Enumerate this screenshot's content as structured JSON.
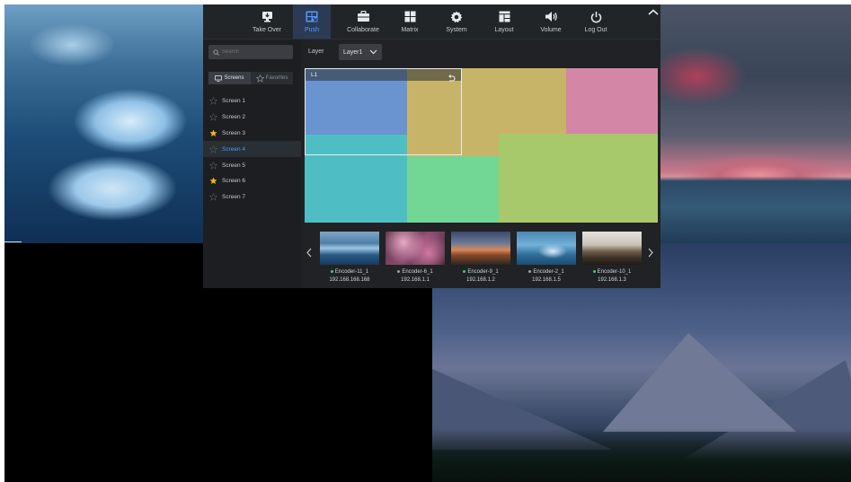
{
  "nav": {
    "items": [
      {
        "label": "Take Over",
        "icon": "take-over-icon"
      },
      {
        "label": "Push",
        "icon": "push-icon",
        "active": true
      },
      {
        "label": "Collaborate",
        "icon": "collaborate-icon"
      },
      {
        "label": "Matrix",
        "icon": "matrix-icon"
      },
      {
        "label": "System",
        "icon": "system-gear-icon"
      },
      {
        "label": "Layout",
        "icon": "layout-icon"
      },
      {
        "label": "Volume",
        "icon": "volume-icon"
      },
      {
        "label": "Log Out",
        "icon": "power-icon"
      }
    ]
  },
  "sidebar": {
    "search_placeholder": "Search",
    "tabs": {
      "screens": "Screens",
      "favorites": "Favorites"
    },
    "screens": [
      {
        "label": "Screen 1",
        "favorite": false
      },
      {
        "label": "Screen 2",
        "favorite": false
      },
      {
        "label": "Screen 3",
        "favorite": true
      },
      {
        "label": "Screen 4",
        "favorite": false,
        "selected": true
      },
      {
        "label": "Screen  5",
        "favorite": false
      },
      {
        "label": "Screen 6",
        "favorite": true
      },
      {
        "label": "Screen 7",
        "favorite": false
      }
    ]
  },
  "layer": {
    "label": "Layer",
    "selected": "Layer1"
  },
  "canvas": {
    "window_title": "L1",
    "colors": {
      "blue": "#6a94cf",
      "gold": "#c8b468",
      "pink": "#d486a6",
      "teal": "#4fbec4",
      "green_light": "#a8c86c",
      "green_mint": "#72d694"
    }
  },
  "encoders": [
    {
      "name": "Encoder-11_1",
      "ip": "192.168.168.168",
      "online": true
    },
    {
      "name": "Encoder-6_1",
      "ip": "192.168.1.1",
      "online": false
    },
    {
      "name": "Encoder-9_1",
      "ip": "192.168.1.2",
      "online": true
    },
    {
      "name": "Encoder-2_1",
      "ip": "192.168.1.5",
      "online": false
    },
    {
      "name": "Encoder-10_1",
      "ip": "192.168.1.3",
      "online": true
    }
  ]
}
